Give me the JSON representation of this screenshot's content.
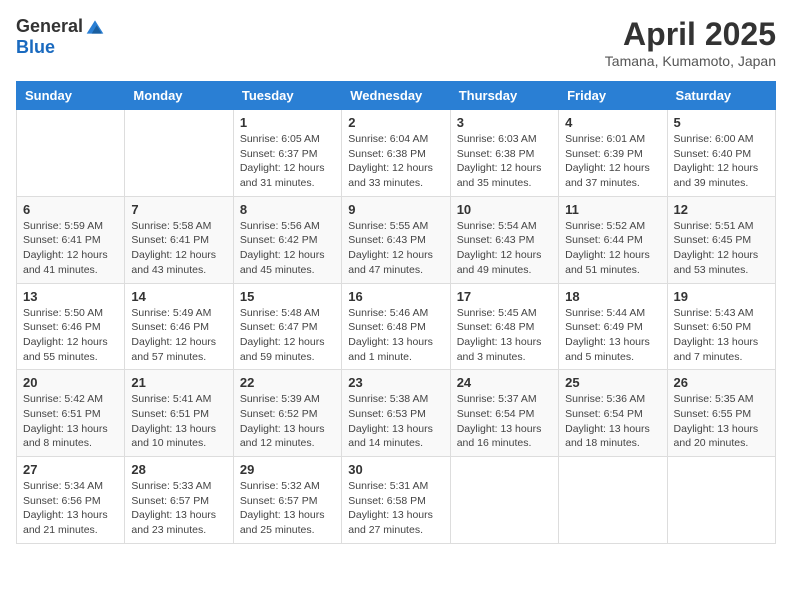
{
  "logo": {
    "general": "General",
    "blue": "Blue"
  },
  "title": "April 2025",
  "subtitle": "Tamana, Kumamoto, Japan",
  "days_of_week": [
    "Sunday",
    "Monday",
    "Tuesday",
    "Wednesday",
    "Thursday",
    "Friday",
    "Saturday"
  ],
  "weeks": [
    [
      {
        "day": "",
        "info": ""
      },
      {
        "day": "",
        "info": ""
      },
      {
        "day": "1",
        "info": "Sunrise: 6:05 AM\nSunset: 6:37 PM\nDaylight: 12 hours\nand 31 minutes."
      },
      {
        "day": "2",
        "info": "Sunrise: 6:04 AM\nSunset: 6:38 PM\nDaylight: 12 hours\nand 33 minutes."
      },
      {
        "day": "3",
        "info": "Sunrise: 6:03 AM\nSunset: 6:38 PM\nDaylight: 12 hours\nand 35 minutes."
      },
      {
        "day": "4",
        "info": "Sunrise: 6:01 AM\nSunset: 6:39 PM\nDaylight: 12 hours\nand 37 minutes."
      },
      {
        "day": "5",
        "info": "Sunrise: 6:00 AM\nSunset: 6:40 PM\nDaylight: 12 hours\nand 39 minutes."
      }
    ],
    [
      {
        "day": "6",
        "info": "Sunrise: 5:59 AM\nSunset: 6:41 PM\nDaylight: 12 hours\nand 41 minutes."
      },
      {
        "day": "7",
        "info": "Sunrise: 5:58 AM\nSunset: 6:41 PM\nDaylight: 12 hours\nand 43 minutes."
      },
      {
        "day": "8",
        "info": "Sunrise: 5:56 AM\nSunset: 6:42 PM\nDaylight: 12 hours\nand 45 minutes."
      },
      {
        "day": "9",
        "info": "Sunrise: 5:55 AM\nSunset: 6:43 PM\nDaylight: 12 hours\nand 47 minutes."
      },
      {
        "day": "10",
        "info": "Sunrise: 5:54 AM\nSunset: 6:43 PM\nDaylight: 12 hours\nand 49 minutes."
      },
      {
        "day": "11",
        "info": "Sunrise: 5:52 AM\nSunset: 6:44 PM\nDaylight: 12 hours\nand 51 minutes."
      },
      {
        "day": "12",
        "info": "Sunrise: 5:51 AM\nSunset: 6:45 PM\nDaylight: 12 hours\nand 53 minutes."
      }
    ],
    [
      {
        "day": "13",
        "info": "Sunrise: 5:50 AM\nSunset: 6:46 PM\nDaylight: 12 hours\nand 55 minutes."
      },
      {
        "day": "14",
        "info": "Sunrise: 5:49 AM\nSunset: 6:46 PM\nDaylight: 12 hours\nand 57 minutes."
      },
      {
        "day": "15",
        "info": "Sunrise: 5:48 AM\nSunset: 6:47 PM\nDaylight: 12 hours\nand 59 minutes."
      },
      {
        "day": "16",
        "info": "Sunrise: 5:46 AM\nSunset: 6:48 PM\nDaylight: 13 hours\nand 1 minute."
      },
      {
        "day": "17",
        "info": "Sunrise: 5:45 AM\nSunset: 6:48 PM\nDaylight: 13 hours\nand 3 minutes."
      },
      {
        "day": "18",
        "info": "Sunrise: 5:44 AM\nSunset: 6:49 PM\nDaylight: 13 hours\nand 5 minutes."
      },
      {
        "day": "19",
        "info": "Sunrise: 5:43 AM\nSunset: 6:50 PM\nDaylight: 13 hours\nand 7 minutes."
      }
    ],
    [
      {
        "day": "20",
        "info": "Sunrise: 5:42 AM\nSunset: 6:51 PM\nDaylight: 13 hours\nand 8 minutes."
      },
      {
        "day": "21",
        "info": "Sunrise: 5:41 AM\nSunset: 6:51 PM\nDaylight: 13 hours\nand 10 minutes."
      },
      {
        "day": "22",
        "info": "Sunrise: 5:39 AM\nSunset: 6:52 PM\nDaylight: 13 hours\nand 12 minutes."
      },
      {
        "day": "23",
        "info": "Sunrise: 5:38 AM\nSunset: 6:53 PM\nDaylight: 13 hours\nand 14 minutes."
      },
      {
        "day": "24",
        "info": "Sunrise: 5:37 AM\nSunset: 6:54 PM\nDaylight: 13 hours\nand 16 minutes."
      },
      {
        "day": "25",
        "info": "Sunrise: 5:36 AM\nSunset: 6:54 PM\nDaylight: 13 hours\nand 18 minutes."
      },
      {
        "day": "26",
        "info": "Sunrise: 5:35 AM\nSunset: 6:55 PM\nDaylight: 13 hours\nand 20 minutes."
      }
    ],
    [
      {
        "day": "27",
        "info": "Sunrise: 5:34 AM\nSunset: 6:56 PM\nDaylight: 13 hours\nand 21 minutes."
      },
      {
        "day": "28",
        "info": "Sunrise: 5:33 AM\nSunset: 6:57 PM\nDaylight: 13 hours\nand 23 minutes."
      },
      {
        "day": "29",
        "info": "Sunrise: 5:32 AM\nSunset: 6:57 PM\nDaylight: 13 hours\nand 25 minutes."
      },
      {
        "day": "30",
        "info": "Sunrise: 5:31 AM\nSunset: 6:58 PM\nDaylight: 13 hours\nand 27 minutes."
      },
      {
        "day": "",
        "info": ""
      },
      {
        "day": "",
        "info": ""
      },
      {
        "day": "",
        "info": ""
      }
    ]
  ]
}
